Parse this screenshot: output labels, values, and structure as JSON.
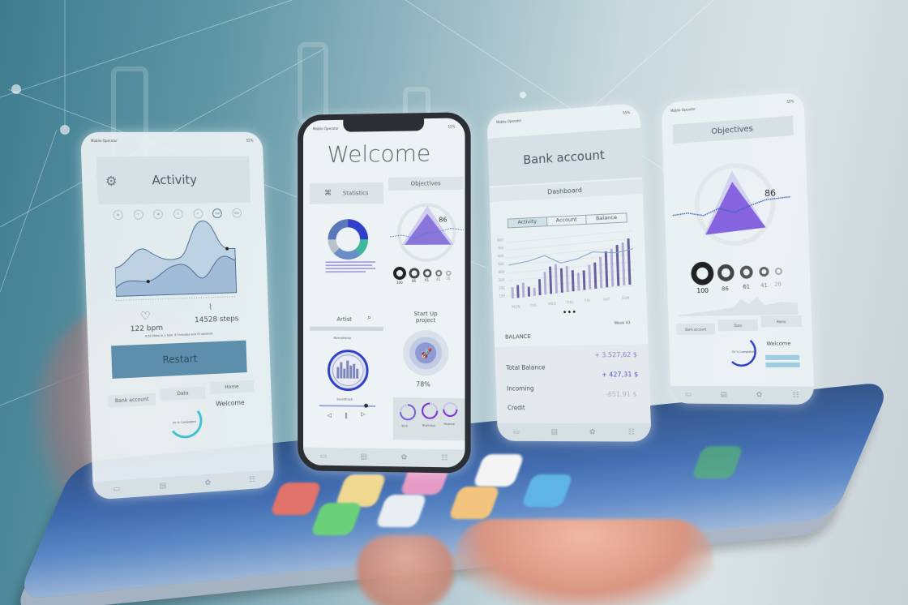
{
  "scene": "Hand holding a smartphone with floating app screen mockups",
  "colors": {
    "accent_blue": "#5d8fac",
    "accent_purple": "#7b5fd6",
    "deep_blue": "#2f3fc8",
    "teal": "#3fc1d0"
  },
  "status_bar": {
    "operator": "Mobile Operator",
    "signal_dots": "•••••",
    "battery": "55%"
  },
  "activity_screen": {
    "title": "Activity",
    "settings_icon": "gear-icon",
    "days": [
      "M",
      "T",
      "W",
      "T",
      "F",
      "Sat",
      "Sun"
    ],
    "active_day": "Sat",
    "heart_rate": "122 bpm",
    "steps": "14528 steps",
    "summary": "8.52 Miles in 1 hour 37 minutes and 31 seconds",
    "restart_label": "Restart",
    "mini_tabs": [
      "Bank account",
      "Data",
      "Home"
    ],
    "mini_progress": "35 % Completed",
    "mini_welcome": "Welcome"
  },
  "welcome_screen": {
    "title": "Welcome",
    "statistics_label": "Statistics",
    "objectives_label": "Objectives",
    "objective_value": "86",
    "rings": [
      "100",
      "86",
      "61",
      "41",
      "28"
    ],
    "artist_label": "Artist",
    "now_playing": "Now playing",
    "track": "Soundtrack",
    "startup_title": "Start Up project",
    "startup_percent": "78%",
    "categories": [
      "Tech",
      "Business",
      "Finance"
    ],
    "progress_playback": 0.8
  },
  "bank_screen": {
    "title": "Bank account",
    "subtitle": "Dashboard",
    "tabs": [
      "Activity",
      "Account",
      "Balance"
    ],
    "active_tab": "Activity",
    "y_ticks": [
      "800",
      "700",
      "600",
      "500",
      "400",
      "300",
      "200",
      "100"
    ],
    "x_days": [
      "MON",
      "TUE",
      "WED",
      "THU",
      "FRI",
      "SAT",
      "SUN"
    ],
    "balance_label": "BALANCE",
    "week": "Week 43",
    "rows": [
      {
        "label": "Total Balance",
        "value": "+ 3.527,62 $"
      },
      {
        "label": "Incoming",
        "value": "+ 427,31 $"
      },
      {
        "label": "Credit",
        "value": "-651,91 $"
      }
    ]
  },
  "objectives_screen": {
    "title": "Objectives",
    "value": "86",
    "rings": [
      "100",
      "86",
      "61",
      "41",
      "28"
    ],
    "mini_tabs": [
      "Bank account",
      "Data",
      "Home"
    ],
    "mini_progress": "35 % Completed",
    "mini_welcome": "Welcome"
  },
  "tabbar_icons": [
    "chat-icon",
    "calendar-icon",
    "settings-icon",
    "users-icon"
  ]
}
